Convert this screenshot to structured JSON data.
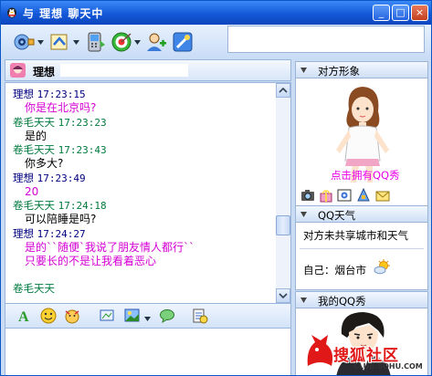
{
  "window": {
    "title": "与 理想 聊天中",
    "minimize": "_",
    "maximize": "□",
    "close": "×"
  },
  "toolbar": {
    "icons": [
      "video-icon",
      "file-transfer-icon",
      "phone-icon",
      "target-icon",
      "add-friend-icon",
      "settings-icon"
    ]
  },
  "contact": {
    "name": "理想"
  },
  "chat": {
    "messages": [
      {
        "sender": "理想",
        "time": "17:23:15",
        "sender_color": "blue",
        "lines": [
          "你是在北京吗?"
        ],
        "text_color": "magenta"
      },
      {
        "sender": "卷毛天天",
        "time": "17:23:23",
        "sender_color": "green",
        "lines": [
          "是的"
        ],
        "text_color": "black"
      },
      {
        "sender": "卷毛天天",
        "time": "17:23:43",
        "sender_color": "green",
        "lines": [
          "你多大?"
        ],
        "text_color": "black"
      },
      {
        "sender": "理想",
        "time": "17:23:49",
        "sender_color": "blue",
        "lines": [
          "20"
        ],
        "text_color": "magenta"
      },
      {
        "sender": "卷毛天天",
        "time": "17:24:18",
        "sender_color": "green",
        "lines": [
          "可以陪睡是吗?"
        ],
        "text_color": "black"
      },
      {
        "sender": "理想",
        "time": "17:24:27",
        "sender_color": "blue",
        "lines": [
          "是的``随便`我说了朋友情人都行``",
          "只要长的不是让我看着恶心"
        ],
        "text_color": "magenta"
      }
    ],
    "partial_sender": "卷毛天天"
  },
  "format_bar": {
    "icons": [
      "font-icon",
      "emoticon-icon",
      "animated-emoticon-icon",
      "screenshot-icon",
      "image-icon",
      "chat-bubble-icon",
      "history-icon"
    ]
  },
  "right": {
    "avatar_section": {
      "title": "对方形象",
      "link": "点击拥有QQ秀",
      "icons": [
        "camera-icon",
        "gift-icon",
        "photo-icon",
        "blocks-icon",
        "mail-icon"
      ]
    },
    "weather_section": {
      "title": "QQ天气",
      "partner_text": "对方未共享城市和天气",
      "self_text": "自己：烟台市"
    },
    "show_section": {
      "title": "我的QQ秀"
    }
  },
  "watermark": {
    "brand": "搜狐社区",
    "url": "CLUB.SOHU.COM"
  },
  "colors": {
    "blue": "#000080",
    "green": "#007a3d",
    "magenta": "#d400d4",
    "title_bar": "#1458d8"
  }
}
